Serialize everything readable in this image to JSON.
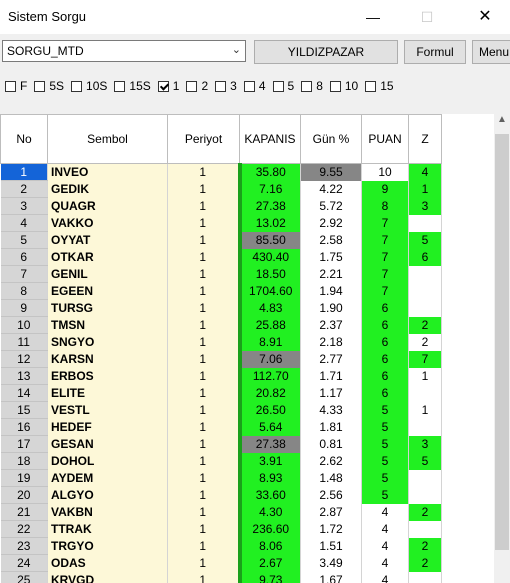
{
  "window": {
    "title": "Sistem Sorgu",
    "min_glyph": "—",
    "max_glyph": "☐",
    "close_glyph": "✕"
  },
  "toolbar": {
    "combo_value": "SORGU_MTD",
    "button1": "YILDIZPAZAR",
    "button2": "Formul",
    "button3": "Menu"
  },
  "checks": [
    {
      "label": "F",
      "checked": false
    },
    {
      "label": "5S",
      "checked": false
    },
    {
      "label": "10S",
      "checked": false
    },
    {
      "label": "15S",
      "checked": false
    },
    {
      "label": "1",
      "checked": true
    },
    {
      "label": "2",
      "checked": false
    },
    {
      "label": "3",
      "checked": false
    },
    {
      "label": "4",
      "checked": false
    },
    {
      "label": "5",
      "checked": false
    },
    {
      "label": "8",
      "checked": false
    },
    {
      "label": "10",
      "checked": false
    },
    {
      "label": "15",
      "checked": false
    }
  ],
  "columns": [
    "No",
    "Sembol",
    "Periyot",
    "KAPANIS",
    "Gün %",
    "PUAN",
    "Z"
  ],
  "colors": {
    "green": "#21f021",
    "gray": "#868686",
    "selected": "#1464d8",
    "symbol_bg": "#fdf8d8"
  },
  "rows": [
    {
      "no": "1",
      "sym": "INVEO",
      "per": "1",
      "kap": "35.80",
      "kapc": "green",
      "gun": "9.55",
      "gunc": "gray",
      "puan": "10",
      "puanc": "white",
      "z": "4",
      "zc": "green"
    },
    {
      "no": "2",
      "sym": "GEDIK",
      "per": "1",
      "kap": "7.16",
      "kapc": "green",
      "gun": "4.22",
      "gunc": "white",
      "puan": "9",
      "puanc": "green",
      "z": "1",
      "zc": "green"
    },
    {
      "no": "3",
      "sym": "QUAGR",
      "per": "1",
      "kap": "27.38",
      "kapc": "green",
      "gun": "5.72",
      "gunc": "white",
      "puan": "8",
      "puanc": "green",
      "z": "3",
      "zc": "green"
    },
    {
      "no": "4",
      "sym": "VAKKO",
      "per": "1",
      "kap": "13.02",
      "kapc": "green",
      "gun": "2.92",
      "gunc": "white",
      "puan": "7",
      "puanc": "green",
      "z": "",
      "zc": "white"
    },
    {
      "no": "5",
      "sym": "OYYAT",
      "per": "1",
      "kap": "85.50",
      "kapc": "gray",
      "gun": "2.58",
      "gunc": "white",
      "puan": "7",
      "puanc": "green",
      "z": "5",
      "zc": "green"
    },
    {
      "no": "6",
      "sym": "OTKAR",
      "per": "1",
      "kap": "430.40",
      "kapc": "green",
      "gun": "1.75",
      "gunc": "white",
      "puan": "7",
      "puanc": "green",
      "z": "6",
      "zc": "green"
    },
    {
      "no": "7",
      "sym": "GENIL",
      "per": "1",
      "kap": "18.50",
      "kapc": "green",
      "gun": "2.21",
      "gunc": "white",
      "puan": "7",
      "puanc": "green",
      "z": "",
      "zc": "white"
    },
    {
      "no": "8",
      "sym": "EGEEN",
      "per": "1",
      "kap": "1704.60",
      "kapc": "green",
      "gun": "1.94",
      "gunc": "white",
      "puan": "7",
      "puanc": "green",
      "z": "",
      "zc": "white"
    },
    {
      "no": "9",
      "sym": "TURSG",
      "per": "1",
      "kap": "4.83",
      "kapc": "green",
      "gun": "1.90",
      "gunc": "white",
      "puan": "6",
      "puanc": "green",
      "z": "",
      "zc": "white"
    },
    {
      "no": "10",
      "sym": "TMSN",
      "per": "1",
      "kap": "25.88",
      "kapc": "green",
      "gun": "2.37",
      "gunc": "white",
      "puan": "6",
      "puanc": "green",
      "z": "2",
      "zc": "green"
    },
    {
      "no": "11",
      "sym": "SNGYO",
      "per": "1",
      "kap": "8.91",
      "kapc": "green",
      "gun": "2.18",
      "gunc": "white",
      "puan": "6",
      "puanc": "green",
      "z": "2",
      "zc": "white"
    },
    {
      "no": "12",
      "sym": "KARSN",
      "per": "1",
      "kap": "7.06",
      "kapc": "gray",
      "gun": "2.77",
      "gunc": "white",
      "puan": "6",
      "puanc": "green",
      "z": "7",
      "zc": "green"
    },
    {
      "no": "13",
      "sym": "ERBOS",
      "per": "1",
      "kap": "112.70",
      "kapc": "green",
      "gun": "1.71",
      "gunc": "white",
      "puan": "6",
      "puanc": "green",
      "z": "1",
      "zc": "white"
    },
    {
      "no": "14",
      "sym": "ELITE",
      "per": "1",
      "kap": "20.82",
      "kapc": "green",
      "gun": "1.17",
      "gunc": "white",
      "puan": "6",
      "puanc": "green",
      "z": "",
      "zc": "white"
    },
    {
      "no": "15",
      "sym": "VESTL",
      "per": "1",
      "kap": "26.50",
      "kapc": "green",
      "gun": "4.33",
      "gunc": "white",
      "puan": "5",
      "puanc": "green",
      "z": "1",
      "zc": "white"
    },
    {
      "no": "16",
      "sym": "HEDEF",
      "per": "1",
      "kap": "5.64",
      "kapc": "green",
      "gun": "1.81",
      "gunc": "white",
      "puan": "5",
      "puanc": "green",
      "z": "",
      "zc": "white"
    },
    {
      "no": "17",
      "sym": "GESAN",
      "per": "1",
      "kap": "27.38",
      "kapc": "gray",
      "gun": "0.81",
      "gunc": "white",
      "puan": "5",
      "puanc": "green",
      "z": "3",
      "zc": "green"
    },
    {
      "no": "18",
      "sym": "DOHOL",
      "per": "1",
      "kap": "3.91",
      "kapc": "green",
      "gun": "2.62",
      "gunc": "white",
      "puan": "5",
      "puanc": "green",
      "z": "5",
      "zc": "green"
    },
    {
      "no": "19",
      "sym": "AYDEM",
      "per": "1",
      "kap": "8.93",
      "kapc": "green",
      "gun": "1.48",
      "gunc": "white",
      "puan": "5",
      "puanc": "green",
      "z": "",
      "zc": "white"
    },
    {
      "no": "20",
      "sym": "ALGYO",
      "per": "1",
      "kap": "33.60",
      "kapc": "green",
      "gun": "2.56",
      "gunc": "white",
      "puan": "5",
      "puanc": "green",
      "z": "",
      "zc": "white"
    },
    {
      "no": "21",
      "sym": "VAKBN",
      "per": "1",
      "kap": "4.30",
      "kapc": "green",
      "gun": "2.87",
      "gunc": "white",
      "puan": "4",
      "puanc": "white",
      "z": "2",
      "zc": "green"
    },
    {
      "no": "22",
      "sym": "TTRAK",
      "per": "1",
      "kap": "236.60",
      "kapc": "green",
      "gun": "1.72",
      "gunc": "white",
      "puan": "4",
      "puanc": "white",
      "z": "",
      "zc": "white"
    },
    {
      "no": "23",
      "sym": "TRGYO",
      "per": "1",
      "kap": "8.06",
      "kapc": "green",
      "gun": "1.51",
      "gunc": "white",
      "puan": "4",
      "puanc": "white",
      "z": "2",
      "zc": "green"
    },
    {
      "no": "24",
      "sym": "ODAS",
      "per": "1",
      "kap": "2.67",
      "kapc": "green",
      "gun": "3.49",
      "gunc": "white",
      "puan": "4",
      "puanc": "white",
      "z": "2",
      "zc": "green"
    },
    {
      "no": "25",
      "sym": "KRVGD",
      "per": "1",
      "kap": "9.73",
      "kapc": "green",
      "gun": "1.67",
      "gunc": "white",
      "puan": "4",
      "puanc": "white",
      "z": "",
      "zc": "white"
    }
  ]
}
